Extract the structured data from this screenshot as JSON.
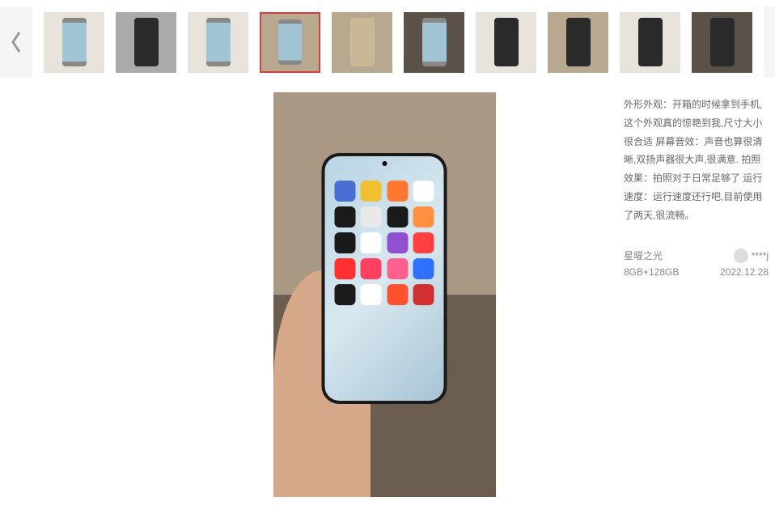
{
  "thumbnails": [
    {
      "type": "phone-front",
      "bg": "light",
      "active": false
    },
    {
      "type": "phone-back",
      "bg": "gray",
      "active": false
    },
    {
      "type": "phone-front",
      "bg": "light",
      "active": false
    },
    {
      "type": "phone-front",
      "bg": "floor",
      "active": true
    },
    {
      "type": "gold",
      "bg": "floor",
      "active": false
    },
    {
      "type": "phone-front",
      "bg": "dark",
      "active": false
    },
    {
      "type": "phone-back",
      "bg": "light",
      "active": false
    },
    {
      "type": "phone-back",
      "bg": "floor",
      "active": false
    },
    {
      "type": "phone-back",
      "bg": "light",
      "active": false
    },
    {
      "type": "phone-back",
      "bg": "dark",
      "active": false
    }
  ],
  "review": {
    "text": "外形外观：开箱的时候拿到手机,这个外观真的惊艳到我,尺寸大小很合适 屏幕音效：声音也算很清晰,双扬声器很大声,很满意. 拍照效果：拍照对于日常足够了 运行速度：运行速度还行吧,目前使用了两天,很流畅。"
  },
  "reviewer": {
    "product_variant": "星曜之光",
    "spec": "8GB+128GB",
    "username": "****j",
    "date": "2022.12.28"
  },
  "phone_apps": [
    "#4a6fd4",
    "#f0c030",
    "#ff7730",
    "#ffffff",
    "#1a1a1a",
    "#e8e8e8",
    "#1a1a1a",
    "#ff9040",
    "#1a1a1a",
    "#ffffff",
    "#9050d0",
    "#ff4040",
    "#ff3030",
    "#ff4060",
    "#ff6090",
    "#3070ff",
    "#1a1a1a",
    "#ffffff",
    "#ff5030",
    "#d03030"
  ]
}
